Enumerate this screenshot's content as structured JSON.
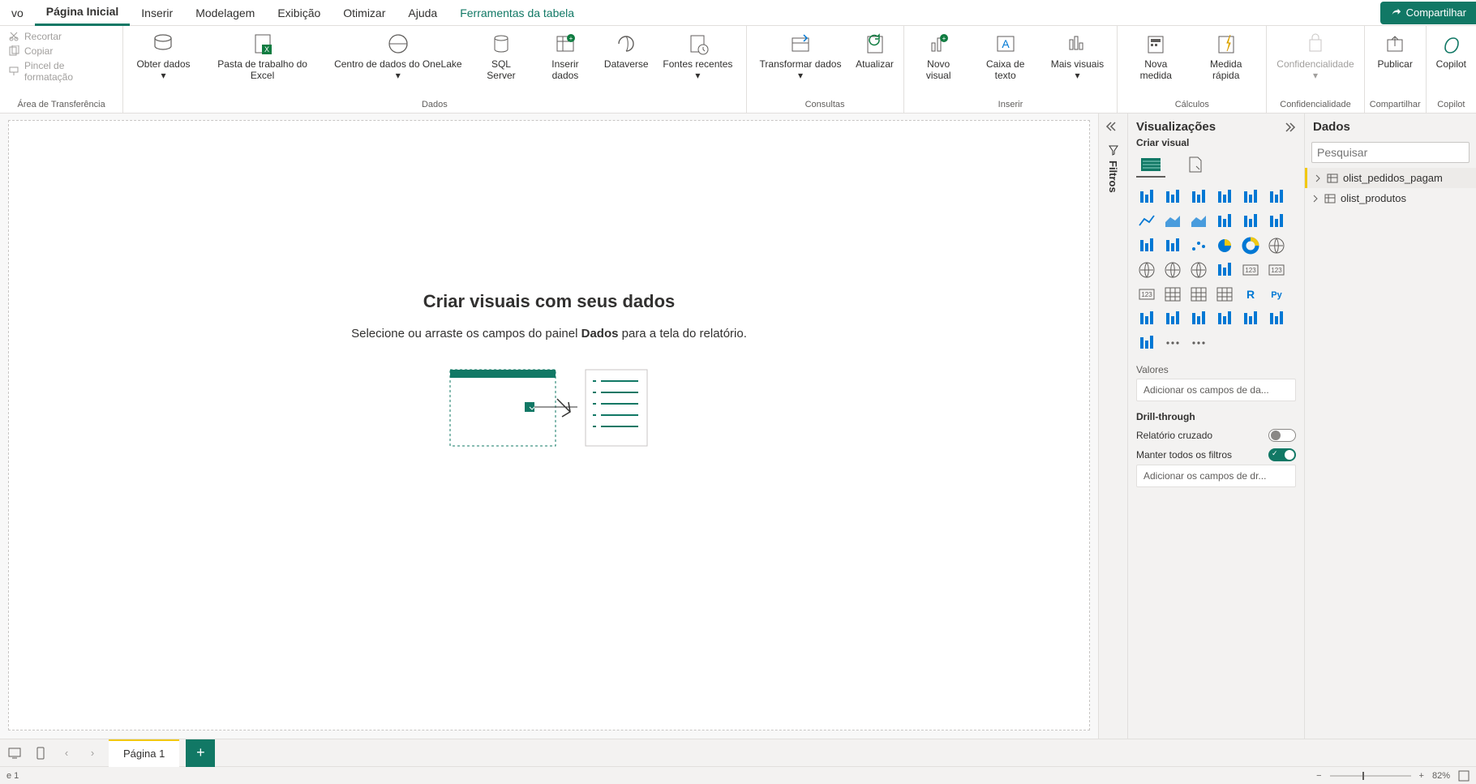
{
  "tabs": {
    "home": "Página Inicial",
    "insert": "Inserir",
    "model": "Modelagem",
    "view": "Exibição",
    "optimize": "Otimizar",
    "help": "Ajuda",
    "table_tools": "Ferramentas da tabela"
  },
  "share_label": "Compartilhar",
  "ribbon": {
    "clipboard": {
      "cut": "Recortar",
      "copy": "Copiar",
      "format_painter": "Pincel de formatação",
      "group": "Área de Transferência"
    },
    "data": {
      "get_data": "Obter dados",
      "excel": "Pasta de trabalho do Excel",
      "onelake": "Centro de dados do OneLake",
      "sql": "SQL Server",
      "enter_data": "Inserir dados",
      "dataverse": "Dataverse",
      "recent": "Fontes recentes",
      "group": "Dados"
    },
    "queries": {
      "transform": "Transformar dados",
      "refresh": "Atualizar",
      "group": "Consultas"
    },
    "insert": {
      "new_visual": "Novo visual",
      "text_box": "Caixa de texto",
      "more_visuals": "Mais visuais",
      "group": "Inserir"
    },
    "calcs": {
      "new_measure": "Nova medida",
      "quick_measure": "Medida rápida",
      "group": "Cálculos"
    },
    "sensitivity": {
      "label": "Confidencialidade",
      "group": "Confidencialidade"
    },
    "share": {
      "publish": "Publicar",
      "group": "Compartilhar"
    },
    "copilot": {
      "label": "Copilot",
      "group": "Copilot"
    }
  },
  "canvas": {
    "title": "Criar visuais com seus dados",
    "subtitle_pre": "Selecione ou arraste os campos do painel ",
    "subtitle_bold": "Dados",
    "subtitle_post": " para a tela do relatório."
  },
  "filters_label": "Filtros",
  "viz": {
    "title": "Visualizações",
    "subtitle": "Criar visual",
    "icons": [
      "stacked-bar",
      "stacked-column",
      "clustered-bar",
      "clustered-column",
      "100-stacked-bar",
      "100-stacked-column",
      "line",
      "area",
      "stacked-area",
      "line-stacked-column",
      "line-clustered-column",
      "ribbon",
      "waterfall",
      "funnel",
      "scatter",
      "pie",
      "donut",
      "treemap",
      "map",
      "filled-map",
      "azure-map",
      "gauge",
      "card",
      "multi-row-card",
      "kpi",
      "slicer",
      "table",
      "matrix",
      "r-visual",
      "py-visual",
      "key-influencers",
      "decomposition-tree",
      "qa",
      "smart-narrative",
      "paginated",
      "power-apps",
      "power-automate",
      "more-visuals",
      "ellipsis"
    ],
    "values_label": "Valores",
    "values_placeholder": "Adicionar os campos de da...",
    "drill_label": "Drill-through",
    "cross_report": "Relatório cruzado",
    "keep_filters": "Manter todos os filtros",
    "drill_placeholder": "Adicionar os campos de dr..."
  },
  "data_pane": {
    "title": "Dados",
    "search_placeholder": "Pesquisar",
    "tables": [
      {
        "name": "olist_pedidos_pagam",
        "selected": true
      },
      {
        "name": "olist_produtos",
        "selected": false
      }
    ]
  },
  "pagebar": {
    "page1": "Página 1"
  },
  "statusbar": {
    "page_info": "e 1",
    "zoom": "82%"
  }
}
